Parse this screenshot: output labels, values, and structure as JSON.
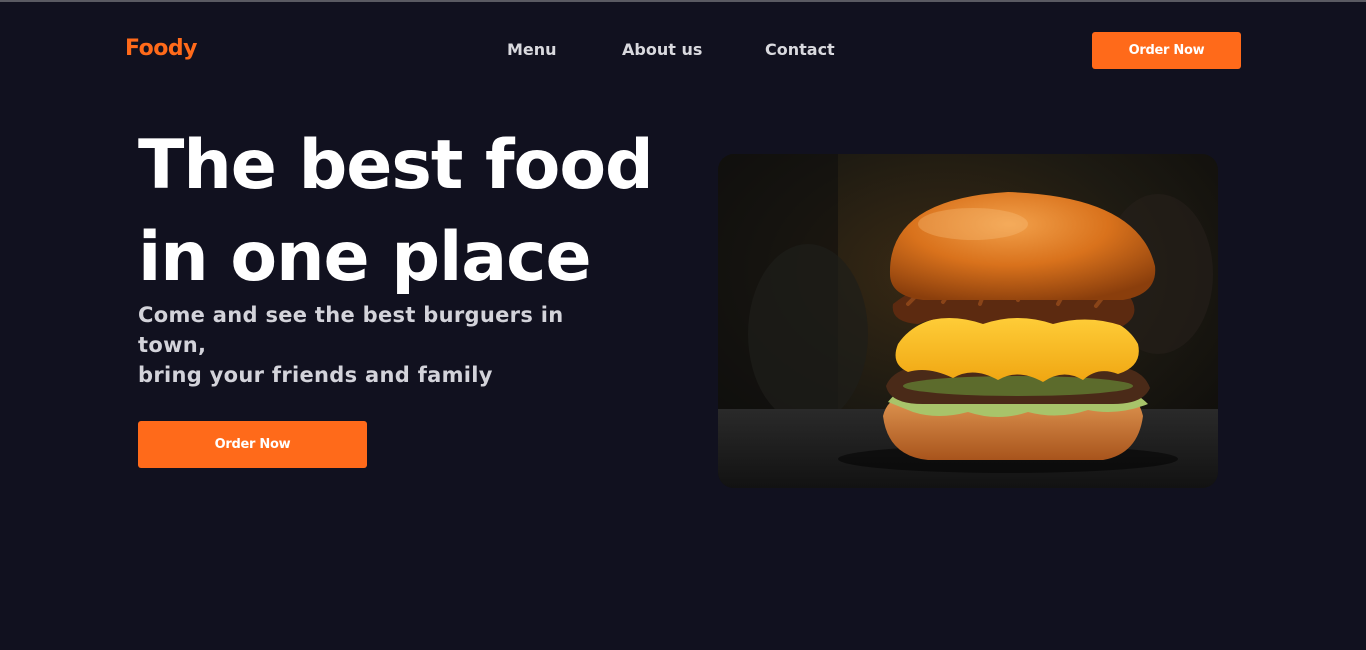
{
  "brand": {
    "name": "Foody",
    "accent": "#ff6a1a",
    "background": "#11111f"
  },
  "nav": {
    "items": [
      {
        "label": "Menu"
      },
      {
        "label": "About us"
      },
      {
        "label": "Contact"
      }
    ],
    "cta_label": "Order Now"
  },
  "hero": {
    "title_line1": "The best food",
    "title_line2": "in one place",
    "subtitle_line1": "Come and see the best burguers in town,",
    "subtitle_line2": "bring your friends and family",
    "cta_label": "Order Now",
    "image": "burger-photo"
  }
}
